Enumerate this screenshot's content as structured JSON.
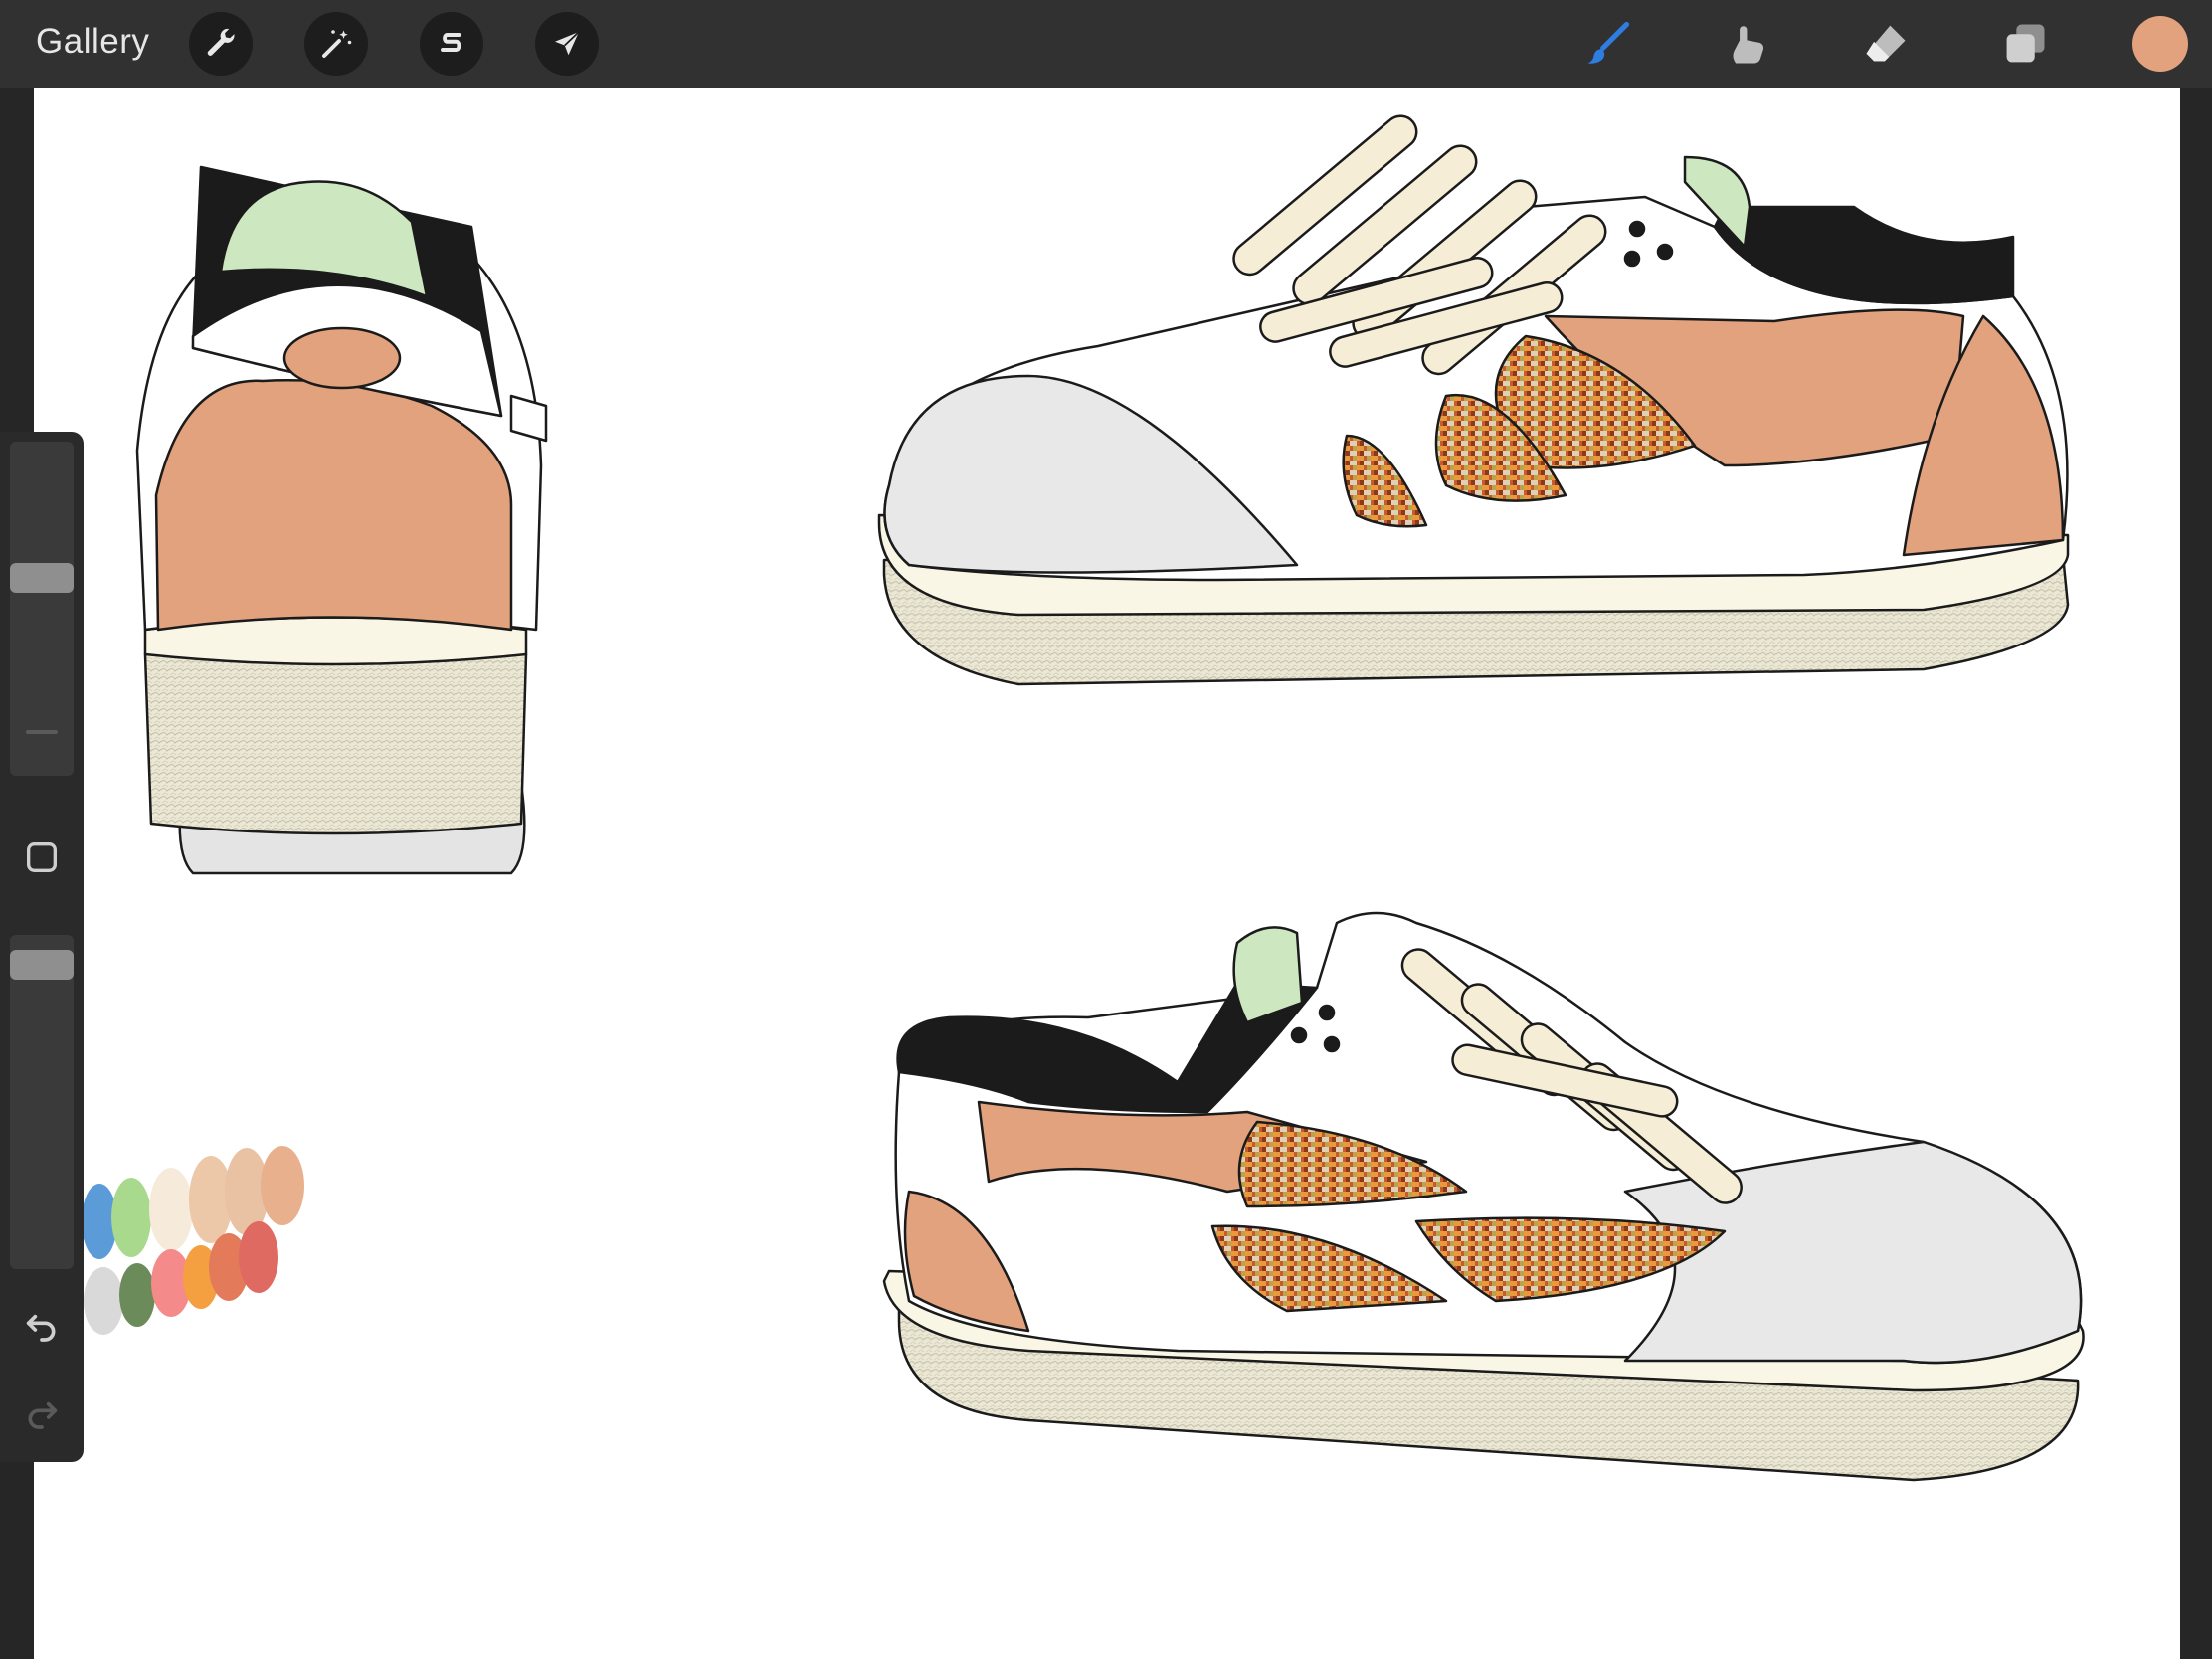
{
  "app": {
    "gallery_label": "Gallery"
  },
  "toolbar": {
    "left_tools": [
      "actions-wrench",
      "adjustments-wand",
      "selection-s",
      "transform-arrow"
    ],
    "right_tools": [
      "brush",
      "smudge",
      "eraser",
      "layers"
    ],
    "current_color": "#E2A27D",
    "active_tool_color": "#2f7de0"
  },
  "sidebar": {
    "size_slider_level": 0.6,
    "opacity_slider_level": 0.95
  },
  "colors": {
    "tan": "#E2A27D",
    "sole": "#F9F6E6",
    "toe": "#E8E8E8",
    "lining": "#1b1b1b",
    "tongue": "#CDE8C0",
    "lace": "#F5EDD5"
  },
  "palette_swatches": [
    "#5b9bd8",
    "#a9d98d",
    "#f6eadb",
    "#ecc7a8",
    "#e9c2a3",
    "#e8b08c",
    "#d9d9d9",
    "#6b8c5a",
    "#f58a8a",
    "#f4a040",
    "#e37a5a",
    "#df6a62"
  ]
}
